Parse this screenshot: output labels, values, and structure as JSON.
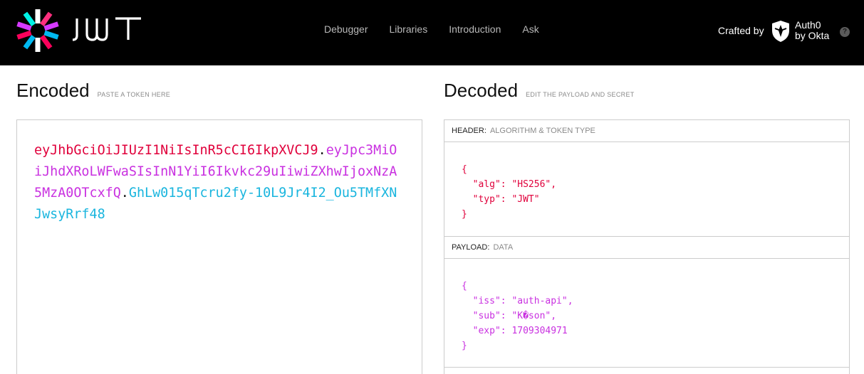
{
  "brand": {
    "logo_icon": "jwt-starburst-icon",
    "wordmark": "JWT",
    "colors": {
      "header_bg": "#000000",
      "token_header": "#e0003b",
      "token_payload": "#c931e0",
      "token_signature": "#19b5de"
    }
  },
  "nav": {
    "items": [
      "Debugger",
      "Libraries",
      "Introduction",
      "Ask"
    ]
  },
  "crafted": {
    "label": "Crafted by",
    "partner_line1": "Auth0",
    "partner_line2": "by Okta",
    "help": "?"
  },
  "encoded": {
    "title": "Encoded",
    "hint": "PASTE A TOKEN HERE",
    "token_header": "eyJhbGciOiJIUzI1NiIsInR5cCI6IkpXVCJ9",
    "token_payload": "eyJpc3MiOiJhdXRoLWFwaSIsInN1YiI6Ikvkc29uIiwiZXhwIjoxNzA5MzA0OTcxfQ",
    "token_signature": "GhLw015qTcru2fy-10L9Jr4I2_Ou5TMfXNJwsyRrf48",
    "dot": "."
  },
  "decoded": {
    "title": "Decoded",
    "hint": "EDIT THE PAYLOAD AND SECRET",
    "header_section": {
      "label": "HEADER:",
      "sublabel": "ALGORITHM & TOKEN TYPE",
      "lines": [
        "{",
        "  \"alg\": \"HS256\",",
        "  \"typ\": \"JWT\"",
        "}"
      ]
    },
    "payload_section": {
      "label": "PAYLOAD:",
      "sublabel": "DATA",
      "lines": [
        "{",
        "  \"iss\": \"auth-api\",",
        "  \"sub\": \"K�son\",",
        "  \"exp\": 1709304971",
        "}"
      ]
    }
  }
}
